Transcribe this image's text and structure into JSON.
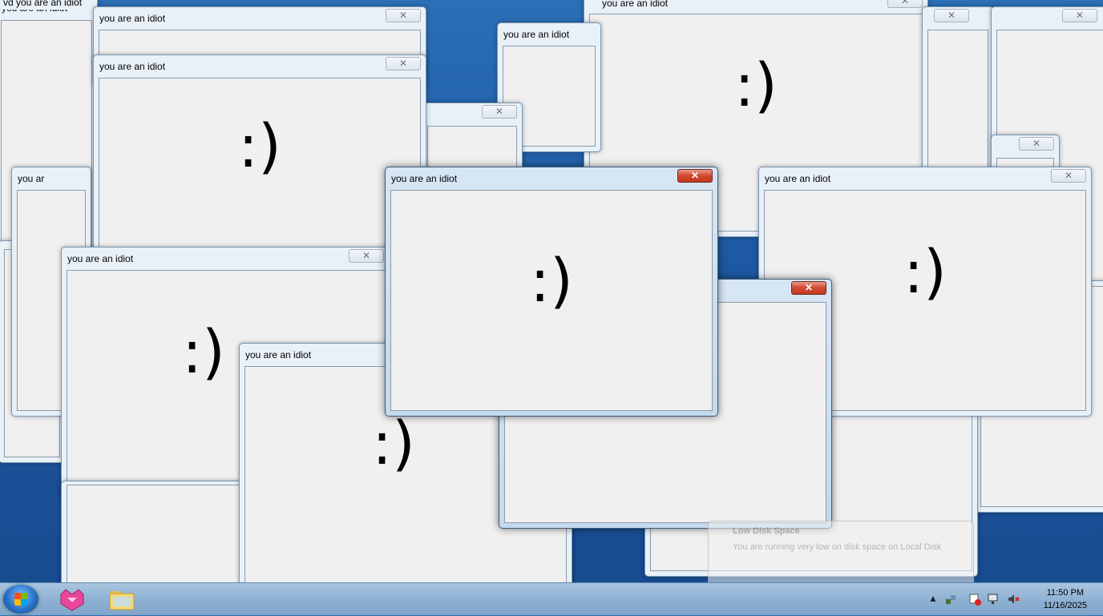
{
  "window_title": "you are an idiot",
  "window_title_partial": "you ar",
  "window_title_vd": "vd  you are an idiot",
  "smiley": ":)",
  "close_glyph": "✕",
  "taskbar": {
    "clock_time": "11:50 PM",
    "clock_date": "11/16/2025"
  },
  "notification": {
    "title": "Low Disk Space",
    "text": "You are running very low on disk space on Local Disk"
  },
  "icons": [
    "windows-start-icon",
    "app-icon",
    "folder-icon",
    "show-hidden-icons-icon",
    "network-icon",
    "action-center-icon",
    "volume-muted-icon"
  ],
  "colors": {
    "active_close": "#c7432b",
    "client_bg": "#f0f0f0",
    "taskbar": "#8fb2d3"
  }
}
